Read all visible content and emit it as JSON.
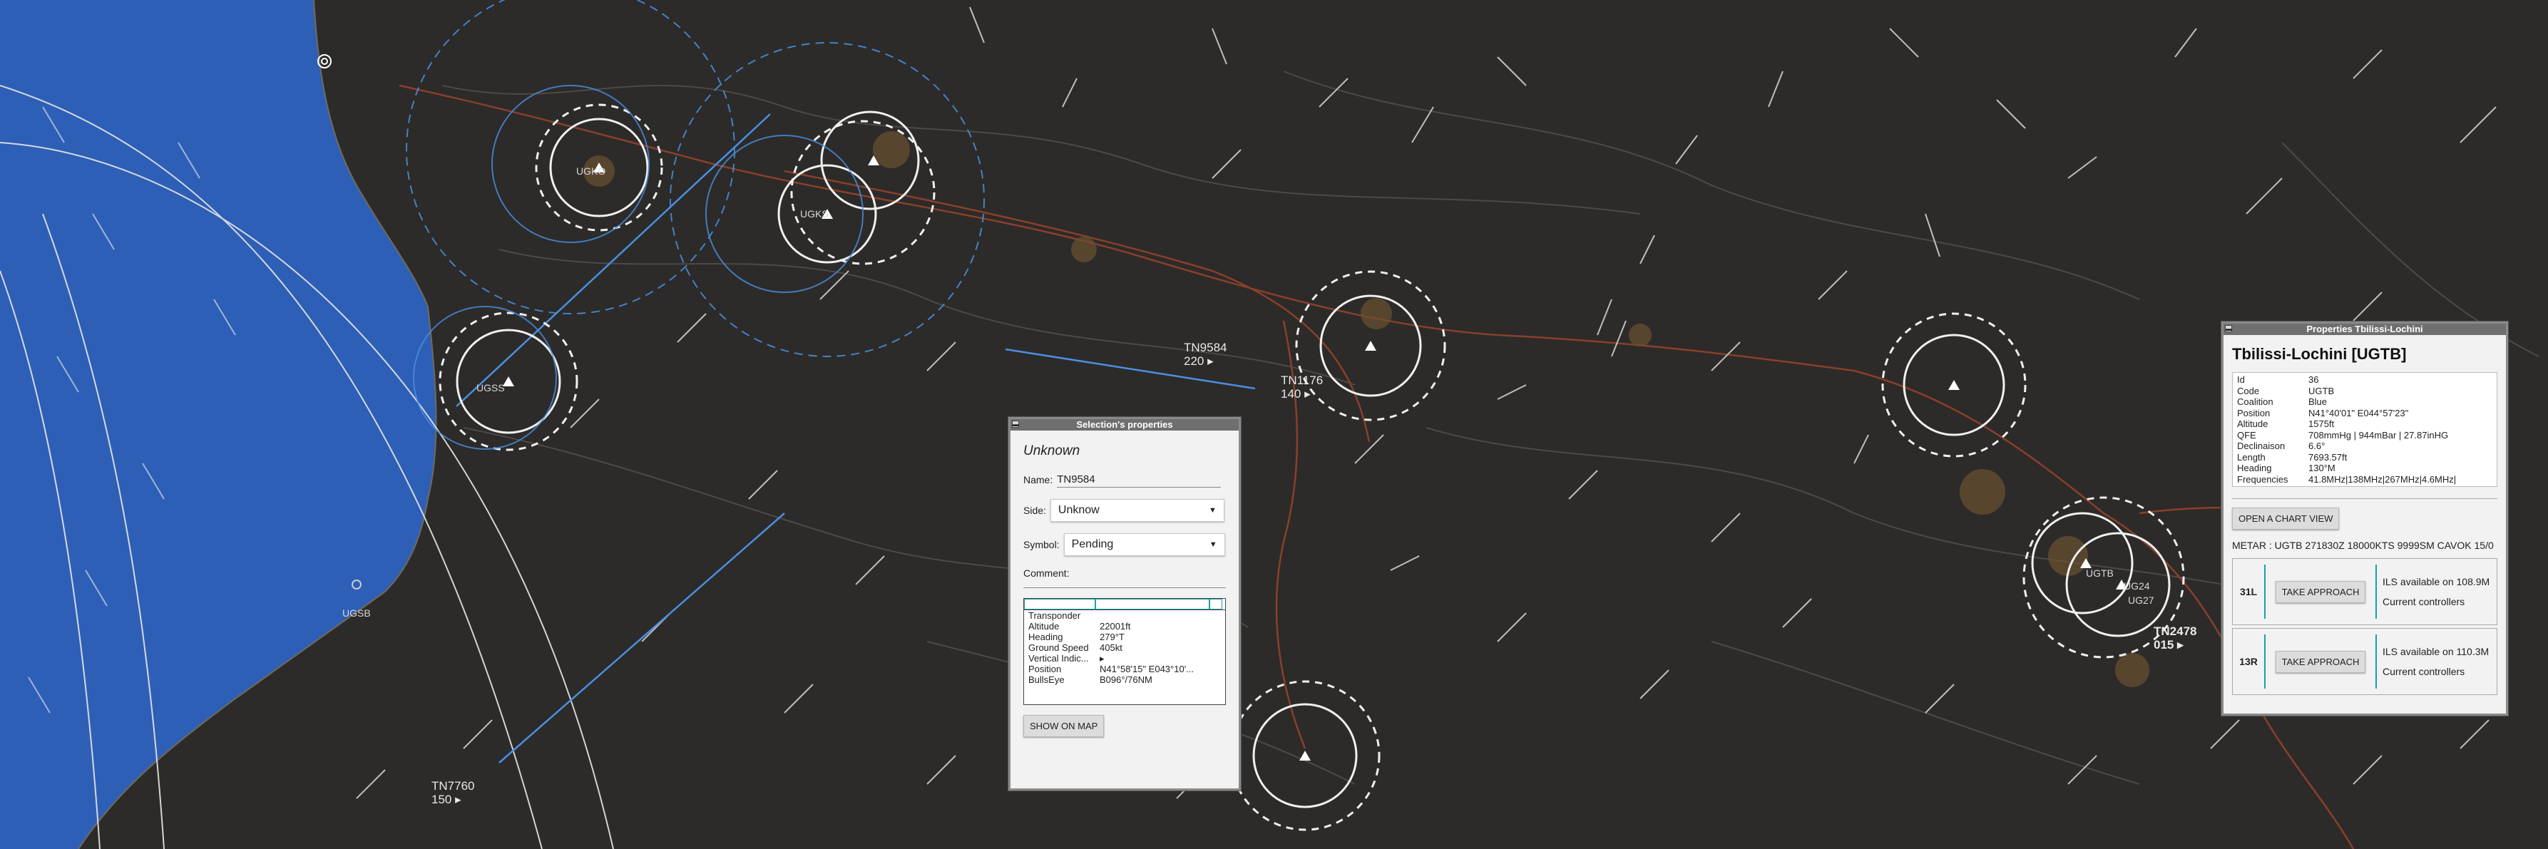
{
  "map": {
    "colors": {
      "sea": "#2e5fb6",
      "land": "#2c2b29",
      "route": "#4a90e2",
      "road": "#9a4a34",
      "river": "#5a5a5a"
    },
    "aircraft": [
      {
        "callsign": "TN9584",
        "alt": "220"
      },
      {
        "callsign": "TN1176",
        "alt": "140"
      },
      {
        "callsign": "TN7760",
        "alt": "150"
      },
      {
        "callsign": "TN2478",
        "alt": "015"
      }
    ],
    "airbases": [
      "UGSB",
      "UGKO",
      "UGKS",
      "UGSS",
      "UGTB",
      "UG24",
      "UG27"
    ]
  },
  "selection": {
    "title": "Selection's properties",
    "heading": "Unknown",
    "name_label": "Name:",
    "name_value": "TN9584",
    "side_label": "Side:",
    "side_value": "Unknow",
    "symbol_label": "Symbol:",
    "symbol_value": "Pending",
    "comment_label": "Comment:",
    "table": [
      {
        "k": "Transponder",
        "v": ""
      },
      {
        "k": "Altitude",
        "v": "22001ft"
      },
      {
        "k": "Heading",
        "v": "279°T"
      },
      {
        "k": "Ground Speed",
        "v": "405kt"
      },
      {
        "k": "Vertical Indic...",
        "v": "▸"
      },
      {
        "k": "Position",
        "v": "N41°58'15\" E043°10'..."
      },
      {
        "k": "BullsEye",
        "v": "B096°/76NM"
      }
    ],
    "show_button": "SHOW ON MAP"
  },
  "properties": {
    "window_title": "Properties Tbilissi-Lochini",
    "title": "Tbilissi-Lochini [UGTB]",
    "info": [
      {
        "k": "Id",
        "v": "36"
      },
      {
        "k": "Code",
        "v": "UGTB"
      },
      {
        "k": "Coalition",
        "v": "Blue"
      },
      {
        "k": "Position",
        "v": "N41°40'01\" E044°57'23\""
      },
      {
        "k": "Altitude",
        "v": "1575ft"
      },
      {
        "k": "QFE",
        "v": "708mmHg | 944mBar | 27.87inHG"
      },
      {
        "k": "Declinaison",
        "v": "6.6°"
      },
      {
        "k": "Length",
        "v": "7693.57ft"
      },
      {
        "k": "Heading",
        "v": "130°M"
      },
      {
        "k": "Frequencies",
        "v": "41.8MHz|138MHz|267MHz|4.6MHz|"
      }
    ],
    "chart_button": "OPEN A CHART VIEW",
    "metar": "METAR : UGTB 271830Z 18000KTS 9999SM CAVOK 15/0",
    "runways": [
      {
        "name": "31L",
        "button": "TAKE APPROACH",
        "ils": "ILS available on 108.9M",
        "controllers": "Current controllers"
      },
      {
        "name": "13R",
        "button": "TAKE APPROACH",
        "ils": "ILS available on 110.3M",
        "controllers": "Current controllers"
      }
    ]
  }
}
